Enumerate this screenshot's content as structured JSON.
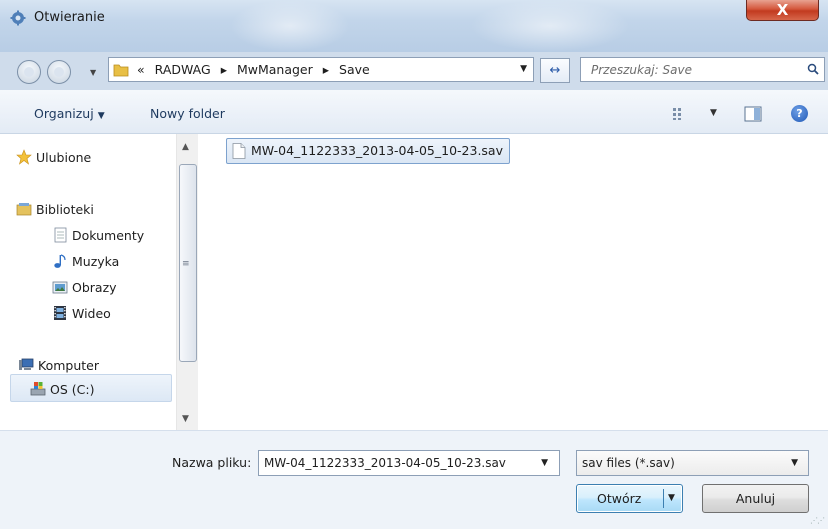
{
  "window": {
    "title": "Otwieranie",
    "close_glyph": "X"
  },
  "nav": {
    "breadcrumb_prefix": "«",
    "breadcrumbs": [
      "RADWAG",
      "MwManager",
      "Save"
    ],
    "separator": "▸",
    "refresh_glyph": "↔",
    "search_placeholder": "Przeszukaj: Save"
  },
  "toolbar": {
    "organize_label": "Organizuj",
    "new_folder_label": "Nowy folder",
    "help_glyph": "?"
  },
  "sidebar": {
    "favorites": "Ulubione",
    "libraries": "Biblioteki",
    "library_items": [
      "Dokumenty",
      "Muzyka",
      "Obrazy",
      "Wideo"
    ],
    "computer": "Komputer",
    "drives": [
      "OS (C:)"
    ]
  },
  "files": [
    {
      "name": "MW-04_1122333_2013-04-05_10-23.sav",
      "icon": "file-icon",
      "selected": true
    }
  ],
  "footer": {
    "filename_label": "Nazwa pliku:",
    "filename_value": "MW-04_1122333_2013-04-05_10-23.sav",
    "filetype_value": "sav files (*.sav)",
    "open_label": "Otwórz",
    "cancel_label": "Anuluj"
  },
  "colors": {
    "accent": "#3c7fb1",
    "titlebar": "#c2d5ea",
    "close": "#c23a1f"
  }
}
